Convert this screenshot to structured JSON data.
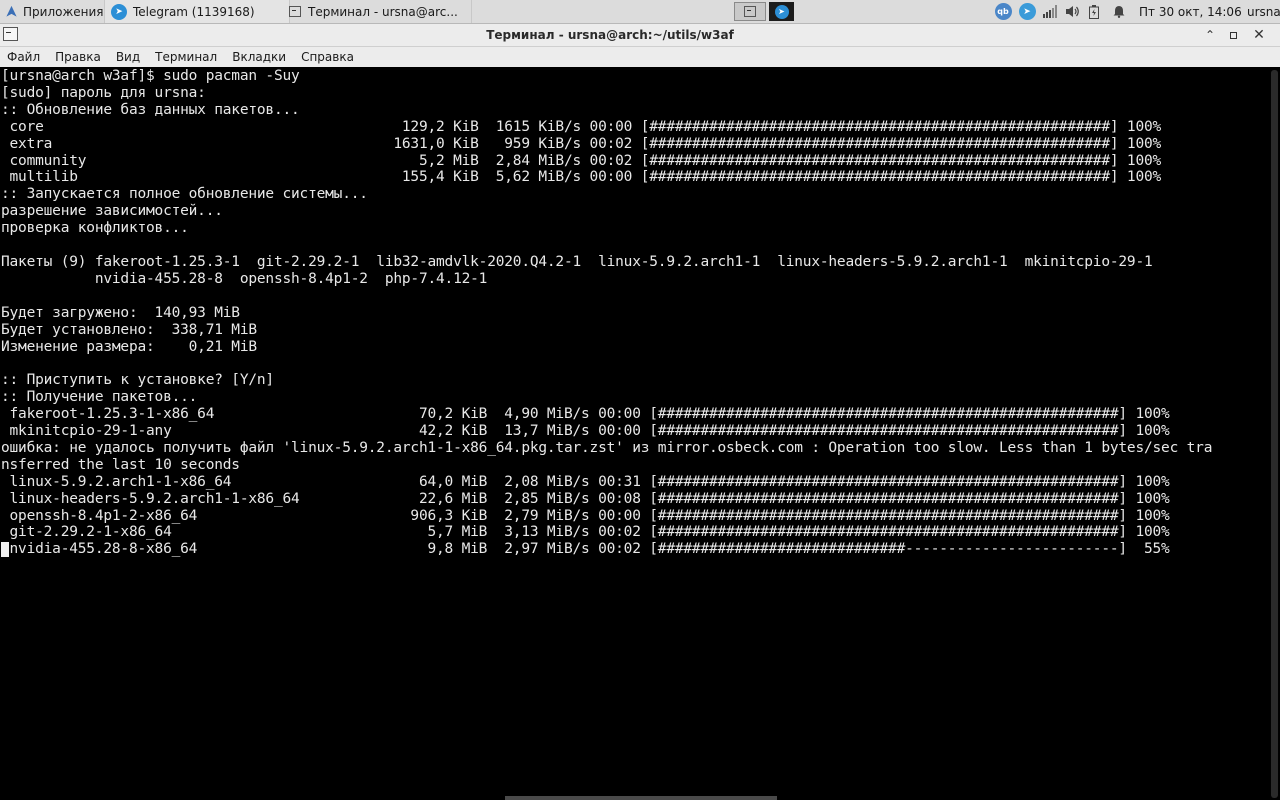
{
  "panel": {
    "apps_label": "Приложения",
    "tasks": [
      {
        "label": "Telegram (1139168)"
      },
      {
        "label": "Терминал - ursna@arc..."
      }
    ],
    "clock": "Пт 30 окт, 14:06",
    "user": "ursna"
  },
  "window": {
    "title": "Терминал - ursna@arch:~/utils/w3af",
    "menu": [
      "Файл",
      "Правка",
      "Вид",
      "Терминал",
      "Вкладки",
      "Справка"
    ]
  },
  "terminal": {
    "lines": [
      "[ursna@arch w3af]$ sudo pacman -Suy",
      "[sudo] пароль для ursna:",
      ":: Обновление баз данных пакетов...",
      " core                                          129,2 KiB  1615 KiB/s 00:00 [######################################################] 100%",
      " extra                                        1631,0 KiB   959 KiB/s 00:02 [######################################################] 100%",
      " community                                       5,2 MiB  2,84 MiB/s 00:02 [######################################################] 100%",
      " multilib                                      155,4 KiB  5,62 MiB/s 00:00 [######################################################] 100%",
      ":: Запускается полное обновление системы...",
      "разрешение зависимостей...",
      "проверка конфликтов...",
      "",
      "Пакеты (9) fakeroot-1.25.3-1  git-2.29.2-1  lib32-amdvlk-2020.Q4.2-1  linux-5.9.2.arch1-1  linux-headers-5.9.2.arch1-1  mkinitcpio-29-1",
      "           nvidia-455.28-8  openssh-8.4p1-2  php-7.4.12-1",
      "",
      "Будет загружено:  140,93 MiB",
      "Будет установлено:  338,71 MiB",
      "Изменение размера:    0,21 MiB",
      "",
      ":: Приступить к установке? [Y/n]",
      ":: Получение пакетов...",
      " fakeroot-1.25.3-1-x86_64                        70,2 KiB  4,90 MiB/s 00:00 [######################################################] 100%",
      " mkinitcpio-29-1-any                             42,2 KiB  13,7 MiB/s 00:00 [######################################################] 100%",
      "ошибка: не удалось получить файл 'linux-5.9.2.arch1-1-x86_64.pkg.tar.zst' из mirror.osbeck.com : Operation too slow. Less than 1 bytes/sec tra",
      "nsferred the last 10 seconds",
      " linux-5.9.2.arch1-1-x86_64                      64,0 MiB  2,08 MiB/s 00:31 [######################################################] 100%",
      " linux-headers-5.9.2.arch1-1-x86_64              22,6 MiB  2,85 MiB/s 00:08 [######################################################] 100%",
      " openssh-8.4p1-2-x86_64                         906,3 KiB  2,79 MiB/s 00:00 [######################################################] 100%",
      " git-2.29.2-1-x86_64                              5,7 MiB  3,13 MiB/s 00:02 [######################################################] 100%",
      " nvidia-455.28-8-x86_64                           9,8 MiB  2,97 MiB/s 00:02 [#############################-------------------------]  55%"
    ]
  },
  "colors": {
    "terminal_bg": "#000000",
    "terminal_fg": "#e8e8e8",
    "panel_bg": "#dcdcdc",
    "telegram": "#2c8fd6"
  }
}
